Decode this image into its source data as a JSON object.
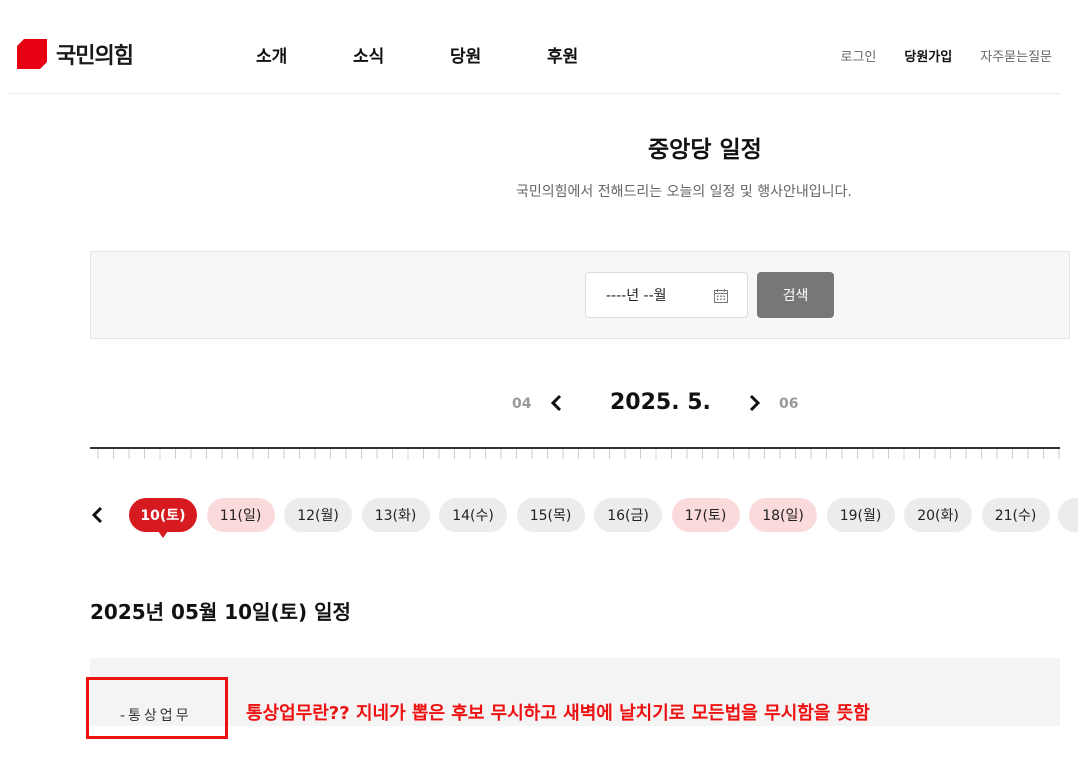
{
  "header": {
    "logo_text": "국민의힘",
    "nav": [
      "소개",
      "소식",
      "당원",
      "후원"
    ],
    "util": {
      "login": "로그인",
      "join": "당원가입",
      "faq": "자주묻는질문"
    }
  },
  "page": {
    "title": "중앙당 일정",
    "subtitle": "국민의힘에서 전해드리는 오늘의 일정 및 행사안내입니다."
  },
  "search": {
    "date_placeholder": "----년 --월",
    "button_label": "검색"
  },
  "month_nav": {
    "prev": "04",
    "current": "2025. 5.",
    "next": "06"
  },
  "days": [
    {
      "label": "10(토)",
      "state": "active"
    },
    {
      "label": "11(일)",
      "state": "weekend"
    },
    {
      "label": "12(월)",
      "state": "normal"
    },
    {
      "label": "13(화)",
      "state": "normal"
    },
    {
      "label": "14(수)",
      "state": "normal"
    },
    {
      "label": "15(목)",
      "state": "normal"
    },
    {
      "label": "16(금)",
      "state": "normal"
    },
    {
      "label": "17(토)",
      "state": "weekend"
    },
    {
      "label": "18(일)",
      "state": "weekend"
    },
    {
      "label": "19(월)",
      "state": "normal"
    },
    {
      "label": "20(화)",
      "state": "normal"
    },
    {
      "label": "21(수)",
      "state": "normal"
    }
  ],
  "schedule": {
    "heading": "2025년 05월 10일(토) 일정",
    "item": "-통상업무"
  },
  "annotation": "통상업무란?? 지네가 뽑은 후보 무시하고 새벽에 날치기로 모든법을 무시함을 뜻함",
  "colors": {
    "brand_red": "#d71920",
    "weekend_pink": "#fadada",
    "chip_gray": "#ececec",
    "annotation_red": "#ee1111",
    "search_button": "#777777"
  }
}
